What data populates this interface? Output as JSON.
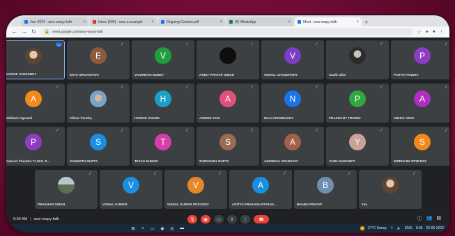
{
  "browser": {
    "tabs": [
      {
        "label": "Join 2024 - sem-wmpy-bdh",
        "color": "blue",
        "active": false
      },
      {
        "label": "Inbox (609) - sam.a.example",
        "color": "red",
        "active": false
      },
      {
        "label": "Ongoing Content.pdf",
        "color": "blue",
        "active": false
      },
      {
        "label": "(5) WhatsApp",
        "color": "green",
        "active": false
      },
      {
        "label": "Meet - sew-wwpy-bdh",
        "color": "blue",
        "active": true
      }
    ],
    "new_tab": "+",
    "url": "meet.google.com/sew-wwpy-bdh",
    "icons": [
      "back-icon",
      "forward-icon",
      "reload-icon",
      "lock-icon",
      "star-icon",
      "extensions-icon",
      "profile-icon",
      "menu-icon"
    ]
  },
  "participants": [
    {
      "name": "SAKSHI VARSHNEY",
      "initial": "",
      "color": "#3c4043",
      "photo": "photo",
      "self": true
    },
    {
      "name": "EKTA SRIVASTAVA",
      "initial": "E",
      "color": "#8d5a3b"
    },
    {
      "name": "VAISHNAVI DUBEY",
      "initial": "V",
      "color": "#1e9e3f"
    },
    {
      "name": "ANKIT PRATAP SINGH",
      "initial": "",
      "color": "#111111",
      "photo": "blank"
    },
    {
      "name": "VISHAL CHAUDHARY",
      "initial": "V",
      "color": "#7b3fc4"
    },
    {
      "name": "mudit alike",
      "initial": "",
      "color": "#3c4043",
      "photo": "dark"
    },
    {
      "name": "PARTH PANDEY",
      "initial": "P",
      "color": "#8e3cc2"
    },
    {
      "name": "Abhilash Agarwal",
      "initial": "A",
      "color": "#f08a1c"
    },
    {
      "name": "Vikhar Pandey",
      "initial": "",
      "color": "#3c4043",
      "photo": "sky"
    },
    {
      "name": "HARDIK ANAND",
      "initial": "H",
      "color": "#1aa0c8"
    },
    {
      "name": "ASHISH JAIN",
      "initial": "A",
      "color": "#e0507a"
    },
    {
      "name": "NILU CHOUDHARY",
      "initial": "N",
      "color": "#1a73e8"
    },
    {
      "name": "PRASHANT TRIVEDI",
      "initial": "P",
      "color": "#2fa83f"
    },
    {
      "name": "ABHAY ARYA",
      "initial": "A",
      "color": "#b02fc1"
    },
    {
      "name": "Prakash Chandra T.I.M.E. D...",
      "initial": "P",
      "color": "#8e3cc2"
    },
    {
      "name": "SAMARTH GUPTA",
      "initial": "S",
      "color": "#1a8fe0"
    },
    {
      "name": "TEJAS KUMAR",
      "initial": "T",
      "color": "#d63fa8"
    },
    {
      "name": "SURYANSH GUPTA",
      "initial": "S",
      "color": "#9a6a52"
    },
    {
      "name": "ANUSHKA UPADHYAY",
      "initial": "A",
      "color": "#a0604a"
    },
    {
      "name": "YASH SANCHETI",
      "initial": "Y",
      "color": "#c9a39a"
    },
    {
      "name": "SIDDHI BH PP20J022",
      "initial": "S",
      "color": "#f08a1c"
    },
    {
      "name": "PRAKHAR SINGH",
      "initial": "",
      "color": "#3c4043",
      "photo": "land"
    },
    {
      "name": "VISHAL KUMAR",
      "initial": "V",
      "color": "#1a8fe0"
    },
    {
      "name": "VISHAL KUMAR PP21G022",
      "initial": "V",
      "color": "#e6882a"
    },
    {
      "name": "ADITYA PRAKASH PP21K0...",
      "initial": "A",
      "color": "#1a8fe0"
    },
    {
      "name": "BHANU PRATAP",
      "initial": "B",
      "color": "#6f8fb0"
    },
    {
      "name": "You",
      "initial": "",
      "color": "#3c4043",
      "photo": "photo"
    }
  ],
  "controls": {
    "time": "9:05 AM",
    "separator": "|",
    "meeting_code": "sew-wwpy-bdh",
    "buttons": [
      "mic-off-icon",
      "camera-off-icon",
      "captions-icon",
      "present-icon",
      "more-icon",
      "end-call-icon"
    ],
    "right": [
      "info-icon",
      "people-icon",
      "chat-icon"
    ]
  },
  "taskbar": {
    "weather": "27°C Sunny",
    "lang": "ENG",
    "time": "9:05",
    "date": "26-06-2022"
  }
}
